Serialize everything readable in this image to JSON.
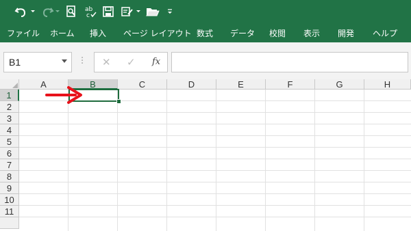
{
  "quick_access": {
    "undo_icon": "undo-icon",
    "redo_icon": "redo-icon",
    "print_preview_icon": "print-preview-icon",
    "spell_check_icon": "spell-check-icon",
    "save_icon": "save-icon",
    "form_icon": "form-edit-icon",
    "open_icon": "open-folder-icon",
    "customize_icon": "customize-qat-icon"
  },
  "ribbon": {
    "tabs": [
      "ファイル",
      "ホーム",
      "挿入",
      "ページ レイアウト",
      "数式",
      "データ",
      "校閲",
      "表示",
      "開発",
      "ヘルプ"
    ]
  },
  "formula_bar": {
    "name_box": "B1",
    "cancel_symbol": "✕",
    "enter_symbol": "✓",
    "fx_symbol": "fx",
    "formula_value": ""
  },
  "sheet": {
    "columns": [
      "A",
      "B",
      "C",
      "D",
      "E",
      "F",
      "G",
      "H"
    ],
    "rows": [
      "1",
      "2",
      "3",
      "4",
      "5",
      "6",
      "7",
      "8",
      "9",
      "10",
      "11"
    ],
    "selected_cell": "B1"
  },
  "colors": {
    "accent": "#217346",
    "annotation_arrow": "#e8121b"
  }
}
